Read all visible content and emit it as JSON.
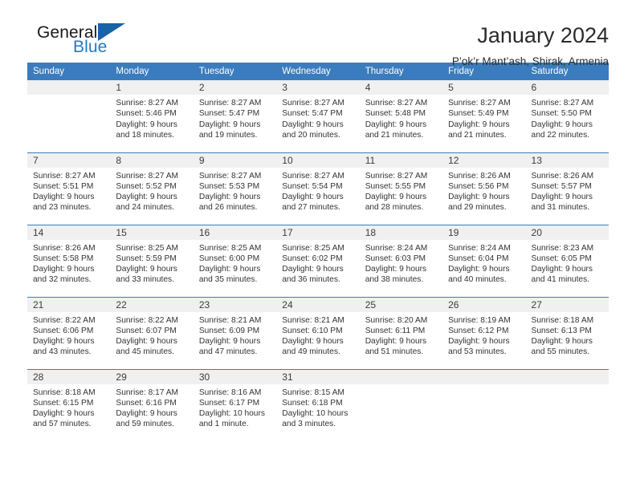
{
  "brand": {
    "word_one": "General",
    "word_two": "Blue",
    "icon": "triangle-logo-icon"
  },
  "header": {
    "title": "January 2024",
    "subtitle": "P’ok’r Mant’ash, Shirak, Armenia"
  },
  "theme": {
    "header_blue": "#3a7cbe",
    "brand_blue": "#1f7ac4",
    "daynum_bg": "#f0f0f0",
    "text": "#333333"
  },
  "weekdays": [
    "Sunday",
    "Monday",
    "Tuesday",
    "Wednesday",
    "Thursday",
    "Friday",
    "Saturday"
  ],
  "labels": {
    "sunrise_prefix": "Sunrise:",
    "sunset_prefix": "Sunset:",
    "daylight_prefix": "Daylight:"
  },
  "weeks": [
    [
      {
        "day": "",
        "empty": true,
        "sunrise": "",
        "sunset": "",
        "daylight_line1": "",
        "daylight_line2": ""
      },
      {
        "day": "1",
        "sunrise": "Sunrise: 8:27 AM",
        "sunset": "Sunset: 5:46 PM",
        "daylight_line1": "Daylight: 9 hours",
        "daylight_line2": "and 18 minutes."
      },
      {
        "day": "2",
        "sunrise": "Sunrise: 8:27 AM",
        "sunset": "Sunset: 5:47 PM",
        "daylight_line1": "Daylight: 9 hours",
        "daylight_line2": "and 19 minutes."
      },
      {
        "day": "3",
        "sunrise": "Sunrise: 8:27 AM",
        "sunset": "Sunset: 5:47 PM",
        "daylight_line1": "Daylight: 9 hours",
        "daylight_line2": "and 20 minutes."
      },
      {
        "day": "4",
        "sunrise": "Sunrise: 8:27 AM",
        "sunset": "Sunset: 5:48 PM",
        "daylight_line1": "Daylight: 9 hours",
        "daylight_line2": "and 21 minutes."
      },
      {
        "day": "5",
        "sunrise": "Sunrise: 8:27 AM",
        "sunset": "Sunset: 5:49 PM",
        "daylight_line1": "Daylight: 9 hours",
        "daylight_line2": "and 21 minutes."
      },
      {
        "day": "6",
        "sunrise": "Sunrise: 8:27 AM",
        "sunset": "Sunset: 5:50 PM",
        "daylight_line1": "Daylight: 9 hours",
        "daylight_line2": "and 22 minutes."
      }
    ],
    [
      {
        "day": "7",
        "sunrise": "Sunrise: 8:27 AM",
        "sunset": "Sunset: 5:51 PM",
        "daylight_line1": "Daylight: 9 hours",
        "daylight_line2": "and 23 minutes."
      },
      {
        "day": "8",
        "sunrise": "Sunrise: 8:27 AM",
        "sunset": "Sunset: 5:52 PM",
        "daylight_line1": "Daylight: 9 hours",
        "daylight_line2": "and 24 minutes."
      },
      {
        "day": "9",
        "sunrise": "Sunrise: 8:27 AM",
        "sunset": "Sunset: 5:53 PM",
        "daylight_line1": "Daylight: 9 hours",
        "daylight_line2": "and 26 minutes."
      },
      {
        "day": "10",
        "sunrise": "Sunrise: 8:27 AM",
        "sunset": "Sunset: 5:54 PM",
        "daylight_line1": "Daylight: 9 hours",
        "daylight_line2": "and 27 minutes."
      },
      {
        "day": "11",
        "sunrise": "Sunrise: 8:27 AM",
        "sunset": "Sunset: 5:55 PM",
        "daylight_line1": "Daylight: 9 hours",
        "daylight_line2": "and 28 minutes."
      },
      {
        "day": "12",
        "sunrise": "Sunrise: 8:26 AM",
        "sunset": "Sunset: 5:56 PM",
        "daylight_line1": "Daylight: 9 hours",
        "daylight_line2": "and 29 minutes."
      },
      {
        "day": "13",
        "sunrise": "Sunrise: 8:26 AM",
        "sunset": "Sunset: 5:57 PM",
        "daylight_line1": "Daylight: 9 hours",
        "daylight_line2": "and 31 minutes."
      }
    ],
    [
      {
        "day": "14",
        "sunrise": "Sunrise: 8:26 AM",
        "sunset": "Sunset: 5:58 PM",
        "daylight_line1": "Daylight: 9 hours",
        "daylight_line2": "and 32 minutes."
      },
      {
        "day": "15",
        "sunrise": "Sunrise: 8:25 AM",
        "sunset": "Sunset: 5:59 PM",
        "daylight_line1": "Daylight: 9 hours",
        "daylight_line2": "and 33 minutes."
      },
      {
        "day": "16",
        "sunrise": "Sunrise: 8:25 AM",
        "sunset": "Sunset: 6:00 PM",
        "daylight_line1": "Daylight: 9 hours",
        "daylight_line2": "and 35 minutes."
      },
      {
        "day": "17",
        "sunrise": "Sunrise: 8:25 AM",
        "sunset": "Sunset: 6:02 PM",
        "daylight_line1": "Daylight: 9 hours",
        "daylight_line2": "and 36 minutes."
      },
      {
        "day": "18",
        "sunrise": "Sunrise: 8:24 AM",
        "sunset": "Sunset: 6:03 PM",
        "daylight_line1": "Daylight: 9 hours",
        "daylight_line2": "and 38 minutes."
      },
      {
        "day": "19",
        "sunrise": "Sunrise: 8:24 AM",
        "sunset": "Sunset: 6:04 PM",
        "daylight_line1": "Daylight: 9 hours",
        "daylight_line2": "and 40 minutes."
      },
      {
        "day": "20",
        "sunrise": "Sunrise: 8:23 AM",
        "sunset": "Sunset: 6:05 PM",
        "daylight_line1": "Daylight: 9 hours",
        "daylight_line2": "and 41 minutes."
      }
    ],
    [
      {
        "day": "21",
        "sunrise": "Sunrise: 8:22 AM",
        "sunset": "Sunset: 6:06 PM",
        "daylight_line1": "Daylight: 9 hours",
        "daylight_line2": "and 43 minutes."
      },
      {
        "day": "22",
        "sunrise": "Sunrise: 8:22 AM",
        "sunset": "Sunset: 6:07 PM",
        "daylight_line1": "Daylight: 9 hours",
        "daylight_line2": "and 45 minutes."
      },
      {
        "day": "23",
        "sunrise": "Sunrise: 8:21 AM",
        "sunset": "Sunset: 6:09 PM",
        "daylight_line1": "Daylight: 9 hours",
        "daylight_line2": "and 47 minutes."
      },
      {
        "day": "24",
        "sunrise": "Sunrise: 8:21 AM",
        "sunset": "Sunset: 6:10 PM",
        "daylight_line1": "Daylight: 9 hours",
        "daylight_line2": "and 49 minutes."
      },
      {
        "day": "25",
        "sunrise": "Sunrise: 8:20 AM",
        "sunset": "Sunset: 6:11 PM",
        "daylight_line1": "Daylight: 9 hours",
        "daylight_line2": "and 51 minutes."
      },
      {
        "day": "26",
        "sunrise": "Sunrise: 8:19 AM",
        "sunset": "Sunset: 6:12 PM",
        "daylight_line1": "Daylight: 9 hours",
        "daylight_line2": "and 53 minutes."
      },
      {
        "day": "27",
        "sunrise": "Sunrise: 8:18 AM",
        "sunset": "Sunset: 6:13 PM",
        "daylight_line1": "Daylight: 9 hours",
        "daylight_line2": "and 55 minutes."
      }
    ],
    [
      {
        "day": "28",
        "sunrise": "Sunrise: 8:18 AM",
        "sunset": "Sunset: 6:15 PM",
        "daylight_line1": "Daylight: 9 hours",
        "daylight_line2": "and 57 minutes."
      },
      {
        "day": "29",
        "sunrise": "Sunrise: 8:17 AM",
        "sunset": "Sunset: 6:16 PM",
        "daylight_line1": "Daylight: 9 hours",
        "daylight_line2": "and 59 minutes."
      },
      {
        "day": "30",
        "sunrise": "Sunrise: 8:16 AM",
        "sunset": "Sunset: 6:17 PM",
        "daylight_line1": "Daylight: 10 hours",
        "daylight_line2": "and 1 minute."
      },
      {
        "day": "31",
        "sunrise": "Sunrise: 8:15 AM",
        "sunset": "Sunset: 6:18 PM",
        "daylight_line1": "Daylight: 10 hours",
        "daylight_line2": "and 3 minutes."
      },
      {
        "day": "",
        "empty": true,
        "sunrise": "",
        "sunset": "",
        "daylight_line1": "",
        "daylight_line2": ""
      },
      {
        "day": "",
        "empty": true,
        "sunrise": "",
        "sunset": "",
        "daylight_line1": "",
        "daylight_line2": ""
      },
      {
        "day": "",
        "empty": true,
        "sunrise": "",
        "sunset": "",
        "daylight_line1": "",
        "daylight_line2": ""
      }
    ]
  ]
}
